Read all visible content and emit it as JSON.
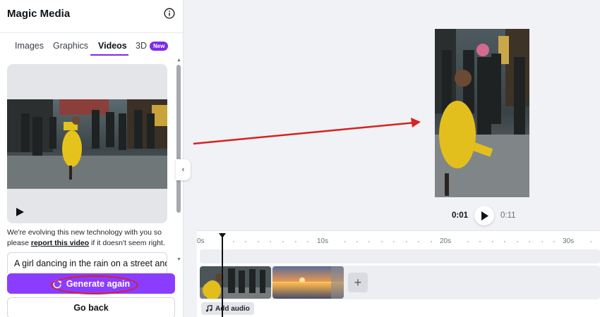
{
  "panel": {
    "title": "Magic Media",
    "tabs": [
      {
        "label": "Images"
      },
      {
        "label": "Graphics"
      },
      {
        "label": "Videos"
      },
      {
        "label": "3D"
      }
    ],
    "new_badge": "New",
    "disclaimer_before": "We're evolving this new technology with you so please ",
    "disclaimer_link": "report this video",
    "disclaimer_after": " if it doesn't seem right.",
    "prompt_text": "A girl dancing in the rain on a street and",
    "generate_label": "Generate again",
    "goback_label": "Go back",
    "scroll_up_glyph": "▲",
    "scroll_down_glyph": "▼",
    "collapse_glyph": "‹",
    "add_clip_glyph": "+"
  },
  "playback": {
    "current_time": "0:01",
    "total_time": "0:11"
  },
  "timeline": {
    "ticks": [
      "0s",
      "10s",
      "20s",
      "30s"
    ],
    "add_audio_label": "Add audio"
  },
  "colors": {
    "accent": "#8b3dff",
    "tab_underline": "#7d2ae8",
    "annotation": "#d62222"
  },
  "icons": [
    "info-icon",
    "play-icon",
    "refresh-icon",
    "music-note-icon",
    "chevron-left-icon",
    "plus-icon"
  ]
}
